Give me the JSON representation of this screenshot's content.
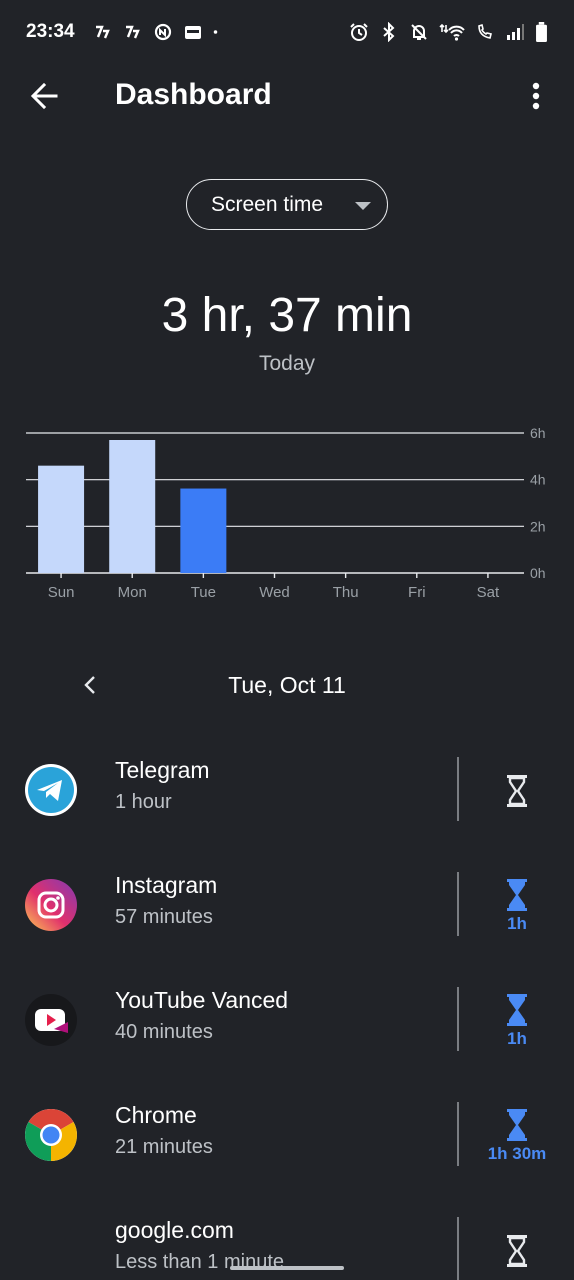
{
  "status_bar": {
    "time": "23:34",
    "left_icons": [
      "notification-icon",
      "notification-icon",
      "notification-icon",
      "notification-icon",
      "dot-icon"
    ],
    "right_icons": [
      "alarm-icon",
      "bluetooth-icon",
      "mute-icon",
      "wifi-icon",
      "call-icon",
      "signal-icon",
      "battery-icon"
    ]
  },
  "appbar": {
    "title": "Dashboard"
  },
  "selector": {
    "value": "Screen time"
  },
  "summary": {
    "total": "3 hr, 37 min",
    "period": "Today"
  },
  "chart_data": {
    "type": "bar",
    "categories": [
      "Sun",
      "Mon",
      "Tue",
      "Wed",
      "Thu",
      "Fri",
      "Sat"
    ],
    "values": [
      4.6,
      5.7,
      3.62,
      0,
      0,
      0,
      0
    ],
    "y_ticks": [
      "0h",
      "2h",
      "4h",
      "6h"
    ],
    "ylim": [
      0,
      6
    ],
    "selected_index": 2,
    "colors": {
      "bar": "#c5d8fb",
      "selected": "#3b7cf6",
      "grid": "#e8eaed",
      "label": "#9aa0a6"
    },
    "grid": true
  },
  "date_nav": {
    "label": "Tue, Oct 11"
  },
  "apps": [
    {
      "name": "Telegram",
      "time": "1 hour",
      "timer": "",
      "timer_set": false,
      "icon": "telegram-icon"
    },
    {
      "name": "Instagram",
      "time": "57 minutes",
      "timer": "1h",
      "timer_set": true,
      "icon": "instagram-icon"
    },
    {
      "name": "YouTube Vanced",
      "time": "40 minutes",
      "timer": "1h",
      "timer_set": true,
      "icon": "youtube-vanced-icon"
    },
    {
      "name": "Chrome",
      "time": "21 minutes",
      "timer": "1h 30m",
      "timer_set": true,
      "icon": "chrome-icon"
    },
    {
      "name": "google.com",
      "time": "Less than 1 minute",
      "timer": "",
      "timer_set": false,
      "icon": ""
    }
  ],
  "accent": "#4a8af4"
}
